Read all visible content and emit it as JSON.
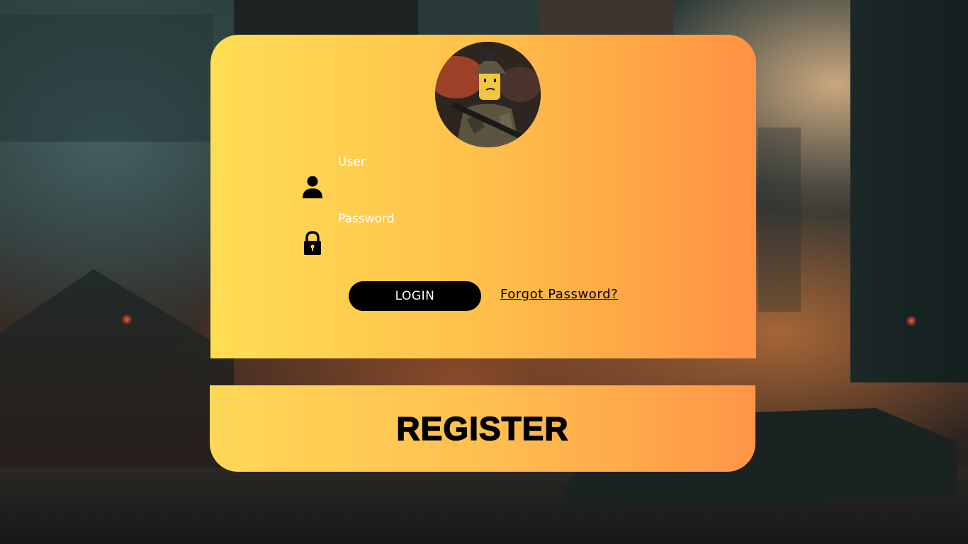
{
  "background": {
    "description_icon": "war-torn-city-background"
  },
  "login_card": {
    "avatar_icon": "soldier-avatar",
    "user": {
      "label": "User",
      "value": "",
      "icon": "user-icon"
    },
    "password": {
      "label": "Password",
      "value": "",
      "icon": "lock-icon"
    },
    "login_button_label": "LOGIN",
    "forgot_password_label": "Forgot Password?"
  },
  "register_card": {
    "label": "REGISTER"
  },
  "colors": {
    "card_gradient_start": "#ffde55",
    "card_gradient_end": "#ff9144",
    "button_bg": "#000000",
    "label_text": "#ffffff"
  }
}
